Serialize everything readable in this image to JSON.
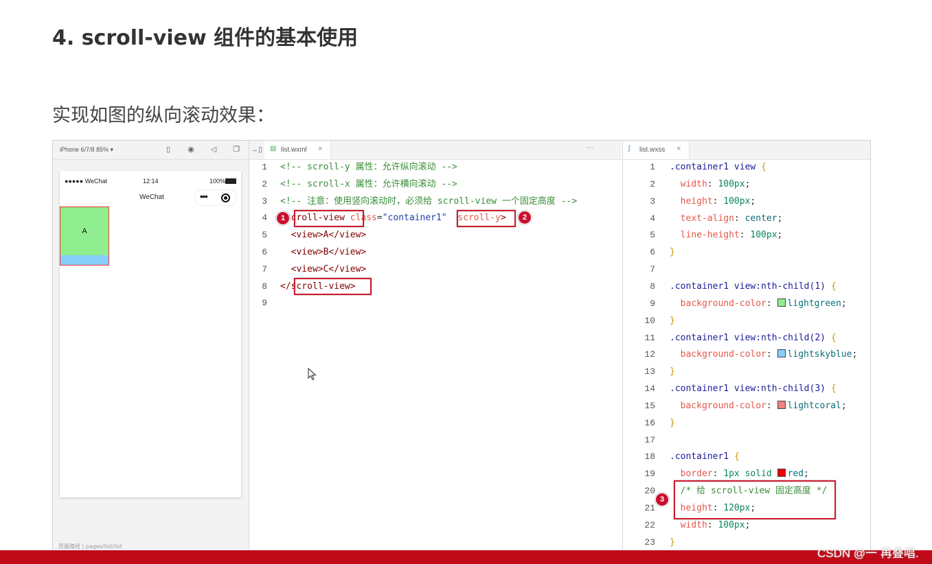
{
  "title": "4. scroll-view 组件的基本使用",
  "subtitle": "实现如图的纵向滚动效果：",
  "simulator": {
    "device": "iPhone 6/7/8 85% ▾",
    "status_signal": "●●●●● WeChat",
    "status_time": "12:14",
    "status_battery": "100%",
    "nav_title": "WeChat",
    "capsule_dots": "•••",
    "box_a_label": "A",
    "bottom_path": "页面路径    |   pages/list/list"
  },
  "editor1": {
    "tab_name": "list.wxml",
    "tab_close": "×",
    "more": "···",
    "lines": [
      {
        "n": "1",
        "comment": "<!-- scroll-y 属性：允许纵向滚动 -->"
      },
      {
        "n": "2",
        "comment": "<!-- scroll-x 属性：允许横向滚动 -->"
      },
      {
        "n": "3",
        "comment": "<!-- 注意：使用竖向滚动时，必须给 scroll-view 一个固定高度 -->"
      },
      {
        "n": "4",
        "open_tag": "<scroll-view",
        "attr": "class",
        "eq": "=",
        "str": "\"container1\"",
        "attr2": "scroll-y",
        "close": ">"
      },
      {
        "n": "5",
        "text": "<view>A</view>"
      },
      {
        "n": "6",
        "text": "<view>B</view>"
      },
      {
        "n": "7",
        "text": "<view>C</view>"
      },
      {
        "n": "8",
        "text": "</scroll-view>"
      },
      {
        "n": "9"
      }
    ]
  },
  "editor2": {
    "tab_name": "list.wxss",
    "tab_close": "×",
    "lines": [
      {
        "n": "1",
        "sel": ".container1 view",
        "brace": "{"
      },
      {
        "n": "2",
        "prop": "width",
        "val": "100px"
      },
      {
        "n": "3",
        "prop": "height",
        "val": "100px"
      },
      {
        "n": "4",
        "prop": "text-align",
        "val": "center"
      },
      {
        "n": "5",
        "prop": "line-height",
        "val": "100px"
      },
      {
        "n": "6",
        "brace": "}"
      },
      {
        "n": "7"
      },
      {
        "n": "8",
        "sel": ".container1 view:nth-child(1)",
        "brace": "{"
      },
      {
        "n": "9",
        "prop": "background-color",
        "val": "lightgreen",
        "swatch": "#90ee90"
      },
      {
        "n": "10",
        "brace": "}"
      },
      {
        "n": "11",
        "sel": ".container1 view:nth-child(2)",
        "brace": "{"
      },
      {
        "n": "12",
        "prop": "background-color",
        "val": "lightskyblue",
        "swatch": "#87cefa"
      },
      {
        "n": "13",
        "brace": "}"
      },
      {
        "n": "14",
        "sel": ".container1 view:nth-child(3)",
        "brace": "{"
      },
      {
        "n": "15",
        "prop": "background-color",
        "val": "lightcoral",
        "swatch": "#f08080"
      },
      {
        "n": "16",
        "brace": "}"
      },
      {
        "n": "17"
      },
      {
        "n": "18",
        "sel": ".container1",
        "brace": "{"
      },
      {
        "n": "19",
        "prop": "border",
        "val": "1px solid",
        "val2": "red",
        "swatch": "#ee0000"
      },
      {
        "n": "20",
        "comment": "/* 给 scroll-view 固定高度 */"
      },
      {
        "n": "21",
        "prop": "height",
        "val": "120px"
      },
      {
        "n": "22",
        "prop": "width",
        "val": "100px"
      },
      {
        "n": "23",
        "brace": "}"
      }
    ]
  },
  "badges": [
    "1",
    "2",
    "3"
  ],
  "watermark": "CSDN @一 再叠唱.",
  "colors": {
    "accent_red": "#d0182b",
    "bottom_bar": "#c00a1a"
  }
}
